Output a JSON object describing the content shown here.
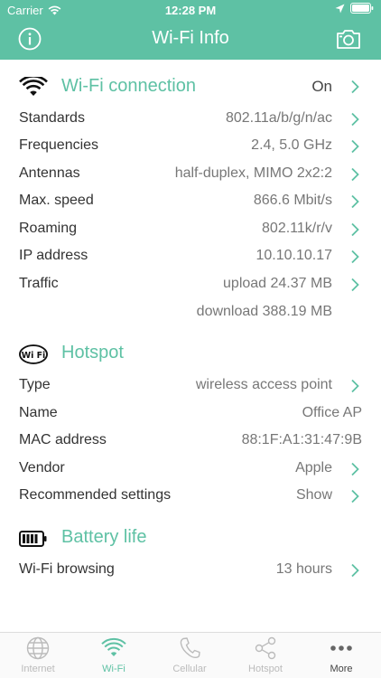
{
  "status_bar": {
    "carrier": "Carrier",
    "time": "12:28 PM"
  },
  "nav": {
    "title": "Wi-Fi Info"
  },
  "wifi": {
    "title": "Wi-Fi connection",
    "value": "On",
    "rows": [
      {
        "label": "Standards",
        "value": "802.11a/b/g/n/ac"
      },
      {
        "label": "Frequencies",
        "value": "2.4, 5.0 GHz"
      },
      {
        "label": "Antennas",
        "value": "half-duplex, MIMO 2x2:2"
      },
      {
        "label": "Max. speed",
        "value": "866.6 Mbit/s"
      },
      {
        "label": "Roaming",
        "value": "802.11k/r/v"
      },
      {
        "label": "IP address",
        "value": "10.10.10.17"
      },
      {
        "label": "Traffic",
        "value": "upload 24.37 MB",
        "value2": "download 388.19 MB"
      }
    ]
  },
  "hotspot": {
    "title": "Hotspot",
    "icon_text": "Wi Fi",
    "rows": [
      {
        "label": "Type",
        "value": "wireless access point"
      },
      {
        "label": "Name",
        "value": "Office AP"
      },
      {
        "label": "MAC address",
        "value": "88:1F:A1:31:47:9B"
      },
      {
        "label": "Vendor",
        "value": "Apple"
      },
      {
        "label": "Recommended settings",
        "value": "Show"
      }
    ]
  },
  "battery": {
    "title": "Battery life",
    "rows": [
      {
        "label": "Wi-Fi browsing",
        "value": "13 hours"
      }
    ]
  },
  "tabs": [
    {
      "label": "Internet",
      "icon": "globe-icon"
    },
    {
      "label": "Wi-Fi",
      "icon": "wifi-icon",
      "active": true
    },
    {
      "label": "Cellular",
      "icon": "phone-icon"
    },
    {
      "label": "Hotspot",
      "icon": "share-icon"
    },
    {
      "label": "More",
      "icon": "more-icon"
    }
  ],
  "colors": {
    "accent": "#5ec1a4",
    "text": "#333333",
    "value_text": "#777777",
    "chevron": "#5ec1a4"
  }
}
